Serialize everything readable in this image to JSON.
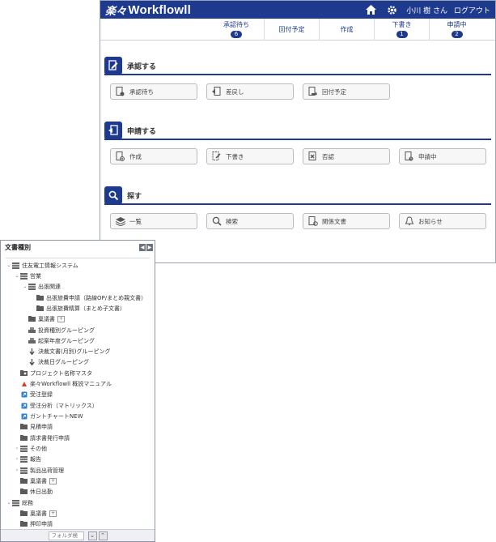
{
  "header": {
    "logo_mark": "楽々",
    "logo_text": "Workflowll",
    "user": "小川 樹 さん",
    "logout": "ログアウト"
  },
  "tabs": [
    {
      "label": "承認待ち",
      "badge": "6"
    },
    {
      "label": "回付予定",
      "badge": ""
    },
    {
      "label": "作成",
      "badge": ""
    },
    {
      "label": "下書き",
      "badge": "1"
    },
    {
      "label": "申請中",
      "badge": "2"
    }
  ],
  "sections": {
    "approve": {
      "title": "承認する",
      "buttons": [
        "承認待ち",
        "差戻し",
        "回付予定"
      ]
    },
    "apply": {
      "title": "申請する",
      "buttons": [
        "作成",
        "下書き",
        "否認",
        "申請中"
      ]
    },
    "search": {
      "title": "探す",
      "buttons": [
        "一覧",
        "検索",
        "関係文書",
        "お知らせ"
      ]
    }
  },
  "tree": {
    "title": "文書種別",
    "nodes": [
      "住友電工情報システム",
      "営業",
      "出張関連",
      "出張旅費申請（路線OP/まとめ親文書）",
      "出張旅費精算（まとめ子文書）",
      "稟議書",
      "投資種別グルーピング",
      "起案年度グルーピング",
      "決裁文書(月別)グルーピング",
      "決裁日グルーピング",
      "プロジェクト名称マスタ",
      "楽々Workflowll 概説マニュアル",
      "受注登録",
      "受注分析（マトリックス）",
      "ガントチャートNEW",
      "見積申請",
      "請求書発行申請",
      "その他",
      "報告",
      "製品出荷管理",
      "稟議書",
      "休日出勤",
      "総務",
      "稟議書",
      "押印申請"
    ],
    "filter_placeholder": "フォルダ検"
  }
}
